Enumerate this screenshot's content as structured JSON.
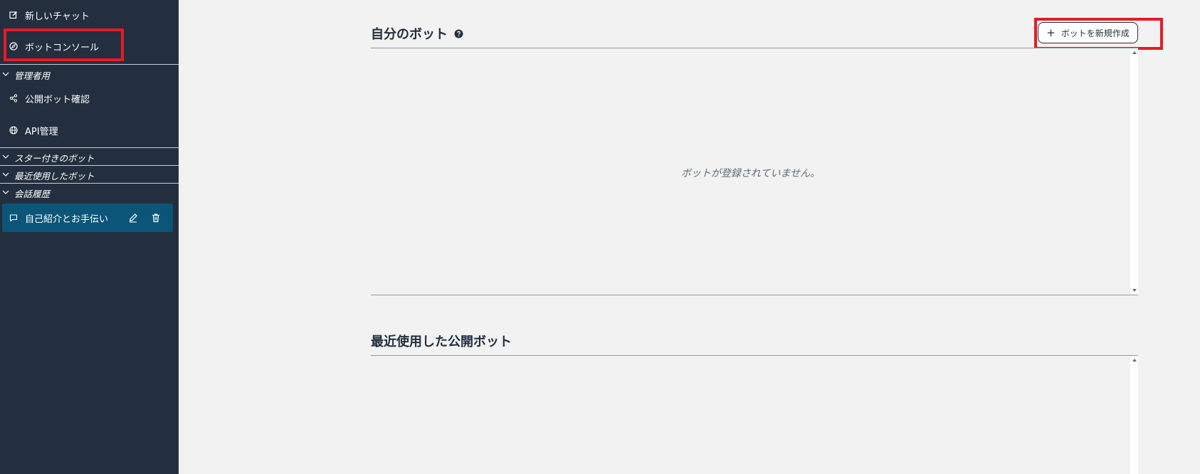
{
  "sidebar": {
    "new_chat": "新しいチャット",
    "bot_console": "ボットコンソール",
    "admin_section": "管理者用",
    "public_bot_review": "公開ボット確認",
    "api_management": "API管理",
    "starred_bots": "スター付きのボット",
    "recent_bots": "最近使用したボット",
    "chat_history": "会話履歴",
    "chat_items": [
      {
        "label": "自己紹介とお手伝い"
      }
    ]
  },
  "main": {
    "my_bots_title": "自分のボット",
    "new_bot_button": "ボットを新規作成",
    "empty_message": "ボットが登録されていません。",
    "recent_public_title": "最近使用した公開ボット"
  },
  "colors": {
    "sidebar_bg": "#232f3e",
    "selected_item_bg": "#0b5578",
    "main_bg": "#f1f2f1",
    "highlight": "#e21d26"
  },
  "icons": {
    "new_chat": "edit-square-icon",
    "bot_console": "compass-icon",
    "public_bot_review": "share-icon",
    "api_management": "globe-icon",
    "chevron": "chevron-down-icon",
    "chat": "chat-bubble-icon",
    "edit": "pencil-icon",
    "delete": "trash-icon",
    "help": "help-circle-icon",
    "plus": "plus-icon"
  }
}
